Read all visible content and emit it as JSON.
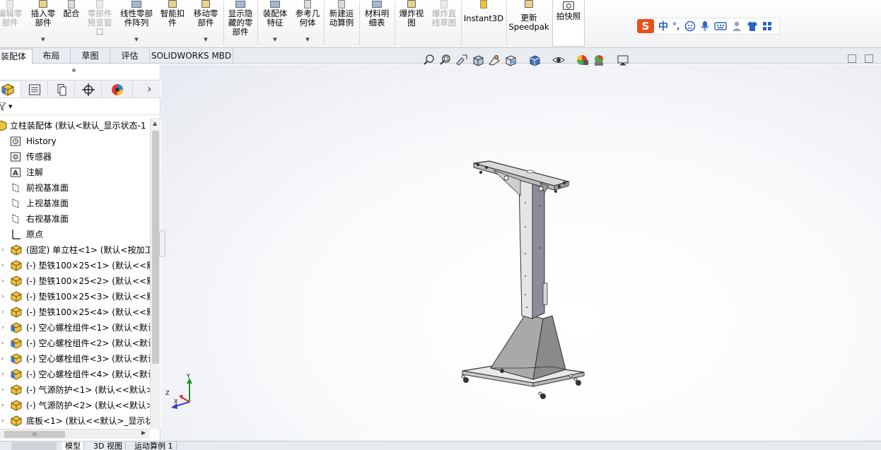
{
  "ribbon": {
    "buttons": [
      {
        "label": "编辑零\n部件",
        "disabled": true
      },
      {
        "label": "插入零\n部件",
        "disabled": false
      },
      {
        "label": "配合",
        "disabled": false
      },
      {
        "label": "零部件\n预览窗\n口",
        "disabled": true
      },
      {
        "label": "线性零部\n件阵列",
        "disabled": false
      },
      {
        "label": "智能扣\n件",
        "disabled": false
      },
      {
        "label": "移动零\n部件",
        "disabled": false
      },
      {
        "label": "显示隐\n藏的零\n部件",
        "disabled": false
      },
      {
        "label": "装配体\n特征",
        "disabled": false
      },
      {
        "label": "参考几\n何体",
        "disabled": false
      },
      {
        "label": "新建运\n动算例",
        "disabled": false
      },
      {
        "label": "材料明\n细表",
        "disabled": false
      },
      {
        "label": "爆炸视\n图",
        "disabled": false
      },
      {
        "label": "爆炸直\n线草图",
        "disabled": true
      },
      {
        "label": "Instant3D",
        "disabled": false
      },
      {
        "label": "更新\nSpeedpak",
        "disabled": false
      }
    ],
    "capture_label": "拍快照"
  },
  "ime": {
    "zh": "中",
    "punct": "°,"
  },
  "cmd_tabs": [
    "装配体",
    "布局",
    "草图",
    "评估",
    "SOLIDWORKS MBD"
  ],
  "tree": {
    "root": "立柱装配体  (默认<默认_显示状态-1",
    "items": [
      {
        "label": "History",
        "icon": "history-icon"
      },
      {
        "label": "传感器",
        "icon": "sensor-icon"
      },
      {
        "label": "注解",
        "icon": "annotation-icon"
      },
      {
        "label": "前视基准面",
        "icon": "plane-icon"
      },
      {
        "label": "上视基准面",
        "icon": "plane-icon"
      },
      {
        "label": "右视基准面",
        "icon": "plane-icon"
      },
      {
        "label": "原点",
        "icon": "origin-icon"
      },
      {
        "label": "(固定) 单立柱<1> (默认<按加工",
        "icon": "part-icon"
      },
      {
        "label": "(-) 垫铁100×25<1> (默认<<默",
        "icon": "part-icon"
      },
      {
        "label": "(-) 垫铁100×25<2> (默认<<默",
        "icon": "part-icon"
      },
      {
        "label": "(-) 垫铁100×25<3> (默认<<默",
        "icon": "part-icon"
      },
      {
        "label": "(-) 垫铁100×25<4> (默认<<默",
        "icon": "part-icon"
      },
      {
        "label": "(-) 空心螺栓组件<1> (默认<默认",
        "icon": "assembly-icon"
      },
      {
        "label": "(-) 空心螺栓组件<2> (默认<默认",
        "icon": "assembly-icon"
      },
      {
        "label": "(-) 空心螺栓组件<3> (默认<默认",
        "icon": "assembly-icon"
      },
      {
        "label": "(-) 空心螺栓组件<4> (默认<默认",
        "icon": "assembly-icon"
      },
      {
        "label": "(-) 气源防护<1> (默认<<默认>",
        "icon": "part-icon"
      },
      {
        "label": "(-) 气源防护<2> (默认<<默认>",
        "icon": "part-icon"
      },
      {
        "label": "底板<1> (默认<<默认>_显示状",
        "icon": "part-icon"
      }
    ]
  },
  "hscroll_label": "III",
  "triad": {
    "x": "X",
    "y": "Y",
    "z": "Z"
  },
  "bottom_tabs": [
    "模型",
    "3D 视图",
    "运动算例 1"
  ],
  "colors": {
    "accent": "#2b62c7",
    "tab_bg": "#e9ecf0",
    "ime_brand": "#e8511d"
  }
}
